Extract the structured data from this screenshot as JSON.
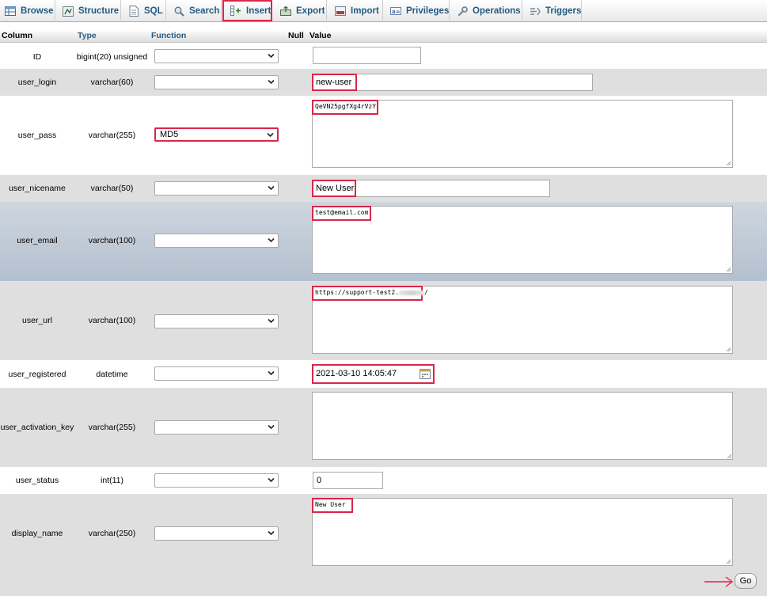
{
  "tabs": [
    {
      "label": "Browse",
      "icon": "browse-icon"
    },
    {
      "label": "Structure",
      "icon": "structure-icon"
    },
    {
      "label": "SQL",
      "icon": "sql-icon"
    },
    {
      "label": "Search",
      "icon": "search-icon"
    },
    {
      "label": "Insert",
      "icon": "insert-icon",
      "active": true
    },
    {
      "label": "Export",
      "icon": "export-icon"
    },
    {
      "label": "Import",
      "icon": "import-icon"
    },
    {
      "label": "Privileges",
      "icon": "privileges-icon"
    },
    {
      "label": "Operations",
      "icon": "wrench-icon"
    },
    {
      "label": "Triggers",
      "icon": "triggers-icon"
    }
  ],
  "header": {
    "column": "Column",
    "type": "Type",
    "function": "Function",
    "null": "Null",
    "value": "Value"
  },
  "fields": [
    {
      "name": "ID",
      "type": "bigint(20) unsigned",
      "function": "",
      "value": ""
    },
    {
      "name": "user_login",
      "type": "varchar(60)",
      "function": "",
      "value": "new-user"
    },
    {
      "name": "user_pass",
      "type": "varchar(255)",
      "function": "MD5",
      "value": "QeVN25pgfXg4rVzY"
    },
    {
      "name": "user_nicename",
      "type": "varchar(50)",
      "function": "",
      "value": "New User"
    },
    {
      "name": "user_email",
      "type": "varchar(100)",
      "function": "",
      "value": "test@email.com"
    },
    {
      "name": "user_url",
      "type": "varchar(100)",
      "function": "",
      "value": "https://support-test2."
    },
    {
      "name": "user_registered",
      "type": "datetime",
      "function": "",
      "value": "2021-03-10 14:05:47"
    },
    {
      "name": "user_activation_key",
      "type": "varchar(255)",
      "function": "",
      "value": ""
    },
    {
      "name": "user_status",
      "type": "int(11)",
      "function": "",
      "value": "0"
    },
    {
      "name": "display_name",
      "type": "varchar(250)",
      "function": "",
      "value": "New User"
    }
  ],
  "url_suffix": "/",
  "go_label": "Go",
  "colors": {
    "link": "#235a81",
    "highlight": "#d9274a",
    "row_alt": "#dfdfdf",
    "row_hover": "#c1cbd8"
  }
}
